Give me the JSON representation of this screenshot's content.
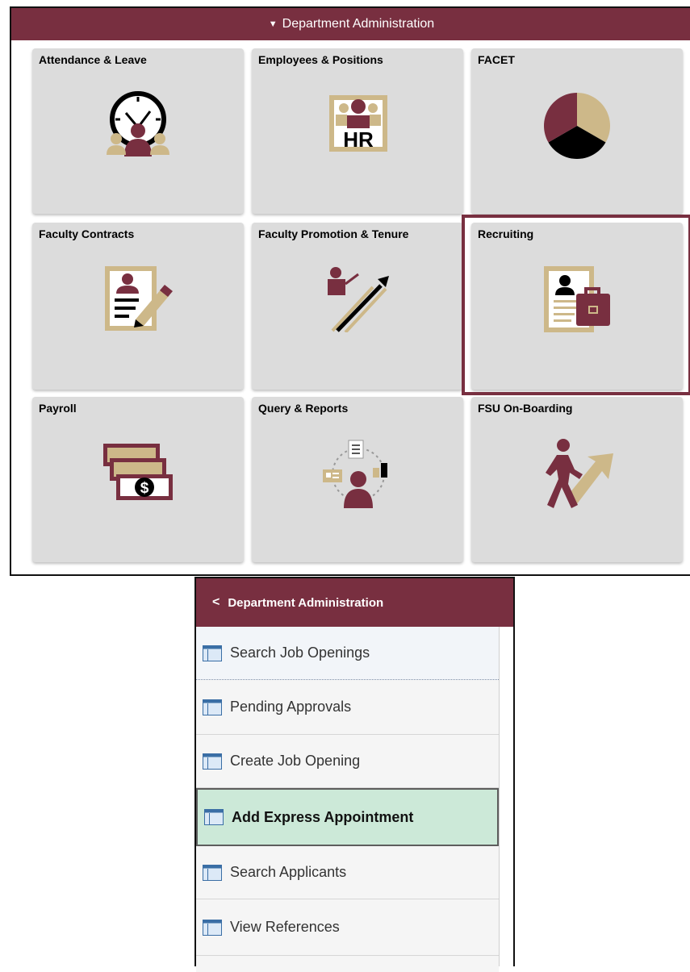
{
  "top_panel": {
    "banner_title": "Department Administration",
    "banner_indicator": "▼",
    "tiles": [
      {
        "title": "Attendance & Leave",
        "icon": "clock-person-icon"
      },
      {
        "title": "Employees & Positions",
        "icon": "hr-badge-icon"
      },
      {
        "title": "FACET",
        "icon": "pie-chart-icon"
      },
      {
        "title": "Faculty Contracts",
        "icon": "contract-signing-icon"
      },
      {
        "title": "Faculty Promotion & Tenure",
        "icon": "ladder-climb-icon"
      },
      {
        "title": "Recruiting",
        "icon": "resume-briefcase-icon",
        "selected": true
      },
      {
        "title": "Payroll",
        "icon": "money-stack-icon"
      },
      {
        "title": "Query & Reports",
        "icon": "query-reports-icon"
      },
      {
        "title": "FSU On-Boarding",
        "icon": "walking-arrow-icon"
      }
    ]
  },
  "menu": {
    "back_chevron": "<",
    "header_title": "Department Administration",
    "items": [
      {
        "label": "Search Job Openings",
        "icon": "page-icon"
      },
      {
        "label": "Pending Approvals",
        "icon": "page-icon"
      },
      {
        "label": "Create Job Opening",
        "icon": "page-icon"
      },
      {
        "label": "Add Express Appointment",
        "icon": "page-icon",
        "active": true
      },
      {
        "label": "Search Applicants",
        "icon": "page-icon"
      },
      {
        "label": "View References",
        "icon": "page-icon"
      }
    ]
  },
  "colors": {
    "garnet": "#782f40",
    "gold": "#cdb889",
    "tile_bg": "#dcdcdc",
    "active_item_bg": "#cce9d8"
  }
}
